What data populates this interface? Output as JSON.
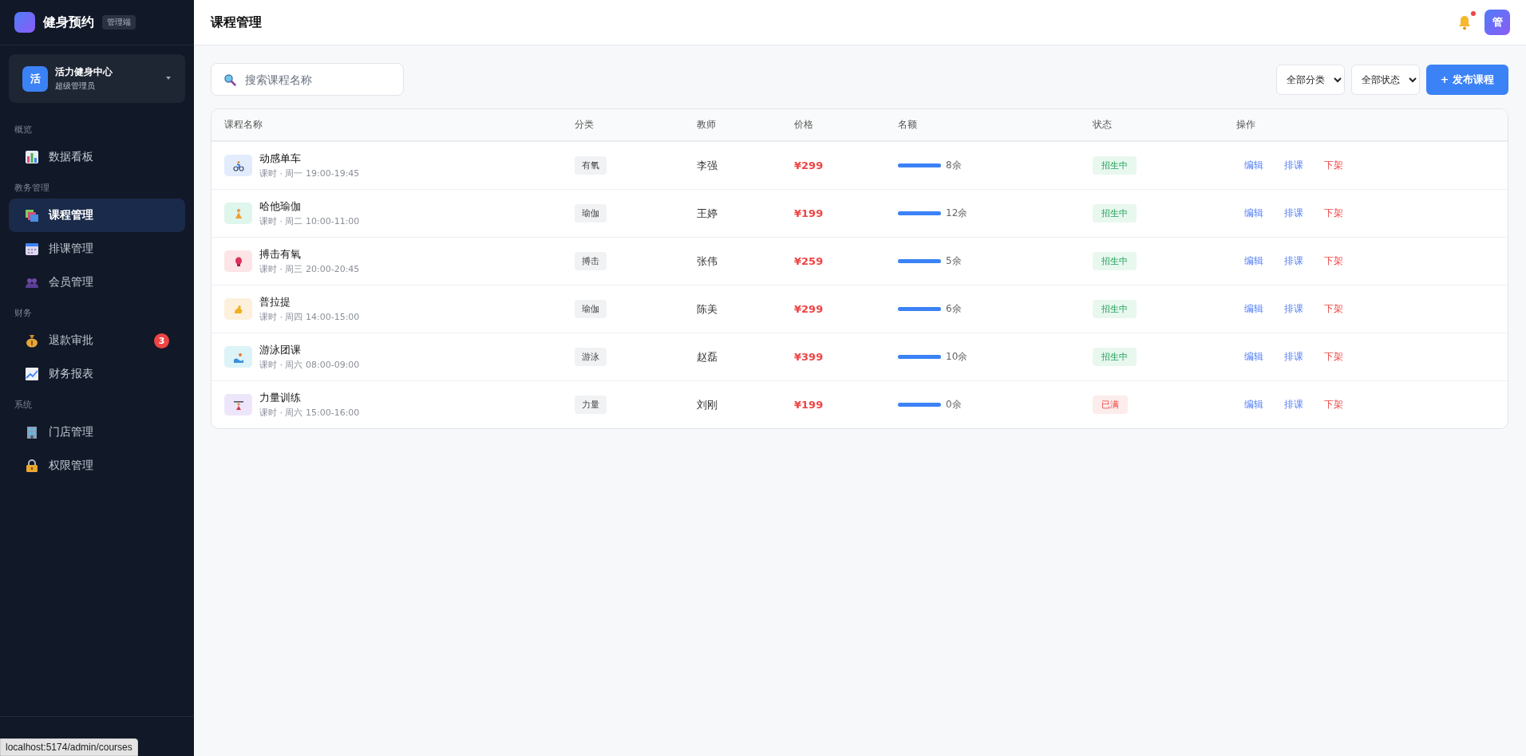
{
  "brand": {
    "name": "健身预约",
    "badge": "管理端"
  },
  "store": {
    "avatar": "活",
    "name": "活力健身中心",
    "role": "超级管理员"
  },
  "nav": [
    {
      "section": "概览",
      "items": [
        {
          "label": "数据看板",
          "selected": false
        }
      ]
    },
    {
      "section": "教务管理",
      "items": [
        {
          "label": "课程管理",
          "selected": true
        },
        {
          "label": "排课管理",
          "selected": false
        },
        {
          "label": "会员管理",
          "selected": false
        }
      ]
    },
    {
      "section": "财务",
      "items": [
        {
          "label": "退款审批",
          "selected": false,
          "count": "3"
        },
        {
          "label": "财务报表",
          "selected": false
        }
      ]
    },
    {
      "section": "系统",
      "items": [
        {
          "label": "门店管理",
          "selected": false
        },
        {
          "label": "权限管理",
          "selected": false
        }
      ]
    }
  ],
  "status_url": "localhost:5174/admin/courses",
  "header": {
    "title": "课程管理",
    "notification": true,
    "avatar": "管"
  },
  "toolbar": {
    "search": {
      "placeholder": "搜索课程名称"
    },
    "filters": [
      "全部分类",
      "全部状态"
    ],
    "primary": "+ 发布课程"
  },
  "table": {
    "columns": [
      "课程名称",
      "分类",
      "教师",
      "价格",
      "名额",
      "状态",
      "操作"
    ],
    "rows": [
      {
        "name": "动感单车",
        "meta": "课时 · 周一 19:00-19:45",
        "color": "#e3ecfd",
        "category": "有氧",
        "teacher": "李强",
        "price": "¥299",
        "level": 1,
        "remaining": "8余",
        "status": {
          "text": "招生中",
          "kind": "open"
        },
        "actions": [
          "编辑",
          "排课",
          "下架"
        ]
      },
      {
        "name": "哈他瑜伽",
        "meta": "课时 · 周二 10:00-11:00",
        "color": "#def6ec",
        "category": "瑜伽",
        "teacher": "王婷",
        "price": "¥199",
        "level": 1,
        "remaining": "12余",
        "status": {
          "text": "招生中",
          "kind": "open"
        },
        "actions": [
          "编辑",
          "排课",
          "下架"
        ]
      },
      {
        "name": "搏击有氧",
        "meta": "课时 · 周三 20:00-20:45",
        "color": "#fde4e6",
        "category": "搏击",
        "teacher": "张伟",
        "price": "¥259",
        "level": 1,
        "remaining": "5余",
        "status": {
          "text": "招生中",
          "kind": "open"
        },
        "actions": [
          "编辑",
          "排课",
          "下架"
        ]
      },
      {
        "name": "普拉提",
        "meta": "课时 · 周四 14:00-15:00",
        "color": "#fdf0dc",
        "category": "瑜伽",
        "teacher": "陈美",
        "price": "¥299",
        "level": 1,
        "remaining": "6余",
        "status": {
          "text": "招生中",
          "kind": "open"
        },
        "actions": [
          "编辑",
          "排课",
          "下架"
        ]
      },
      {
        "name": "游泳团课",
        "meta": "课时 · 周六 08:00-09:00",
        "color": "#dcf3f8",
        "category": "游泳",
        "teacher": "赵磊",
        "price": "¥399",
        "level": 1,
        "remaining": "10余",
        "status": {
          "text": "招生中",
          "kind": "open"
        },
        "actions": [
          "编辑",
          "排课",
          "下架"
        ]
      },
      {
        "name": "力量训练",
        "meta": "课时 · 周六 15:00-16:00",
        "color": "#ede6fb",
        "category": "力量",
        "teacher": "刘刚",
        "price": "¥199",
        "level": 1,
        "remaining": "0余",
        "status": {
          "text": "已满",
          "kind": "full"
        },
        "actions": [
          "编辑",
          "排课",
          "下架"
        ]
      }
    ]
  }
}
